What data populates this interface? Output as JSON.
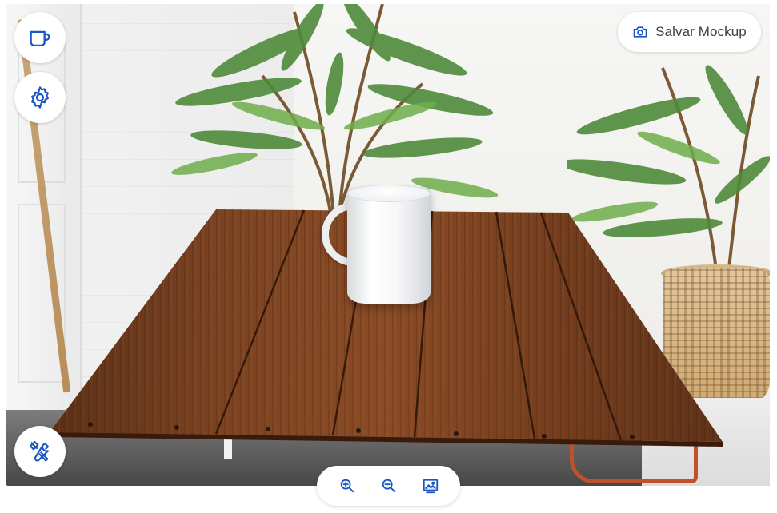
{
  "app": {
    "accent_color": "#1a56c4"
  },
  "toolbar_left": {
    "items": [
      {
        "icon": "mug-icon",
        "label": ""
      },
      {
        "icon": "gear-icon",
        "label": ""
      },
      {
        "icon": "tools-icon",
        "label": ""
      }
    ]
  },
  "header": {
    "save_button_label": "Salvar Mockup",
    "save_button_icon": "camera-icon"
  },
  "zoom_controls": {
    "items": [
      {
        "icon": "zoom-in-icon"
      },
      {
        "icon": "zoom-out-icon"
      },
      {
        "icon": "background-image-icon"
      }
    ]
  },
  "scene": {
    "object": "mug",
    "surface": "wooden-table"
  }
}
